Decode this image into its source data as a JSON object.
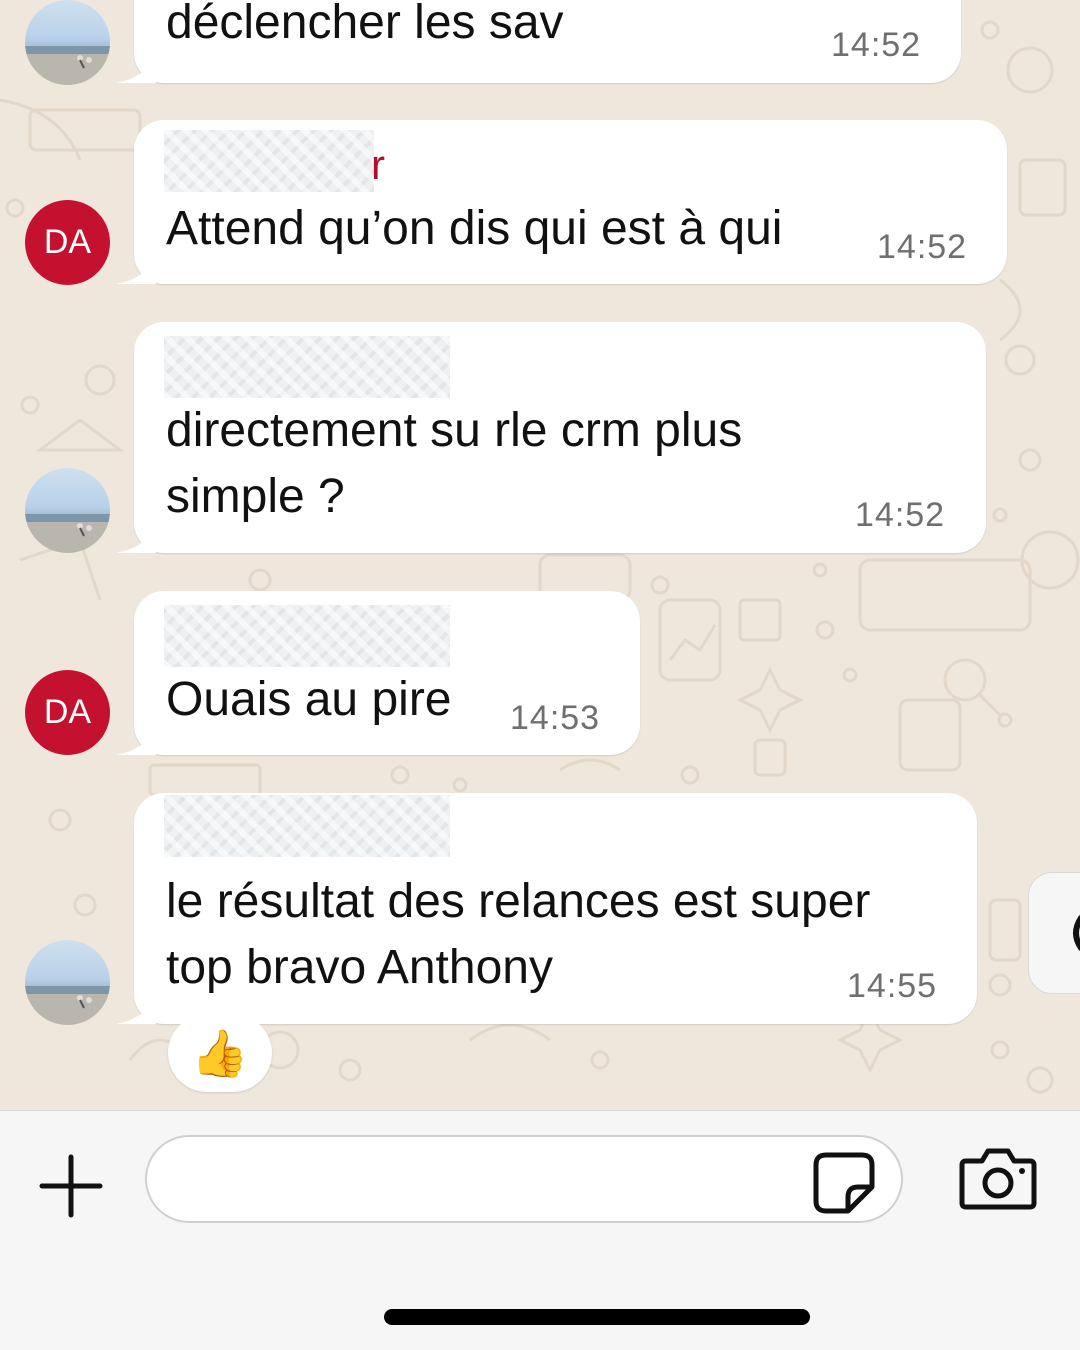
{
  "conversation": {
    "messages": [
      {
        "sender_avatar": "photo",
        "text": "déclencher les sav",
        "time": "14:52"
      },
      {
        "sender_avatar": "DA",
        "sender_name_visible": "r",
        "text": "Attend qu’on dis qui est à qui",
        "time": "14:52"
      },
      {
        "sender_avatar": "photo",
        "text": "directement su rle crm plus\nsimple ?",
        "time": "14:52"
      },
      {
        "sender_avatar": "DA",
        "text": "Ouais au pire",
        "time": "14:53"
      },
      {
        "sender_avatar": "photo",
        "text": "le résultat des relances est super\ntop bravo Anthony",
        "time": "14:55",
        "reaction": "👍"
      }
    ]
  },
  "avatars": {
    "da_initials": "DA"
  },
  "composer": {
    "plus_icon": "plus-icon",
    "sticker_icon": "sticker-icon",
    "camera_icon": "camera-icon",
    "input_value": ""
  },
  "colors": {
    "chat_background": "#efe7dc",
    "bubble": "#ffffff",
    "avatar_da": "#c3112f",
    "sender_name": "#b0102f"
  }
}
